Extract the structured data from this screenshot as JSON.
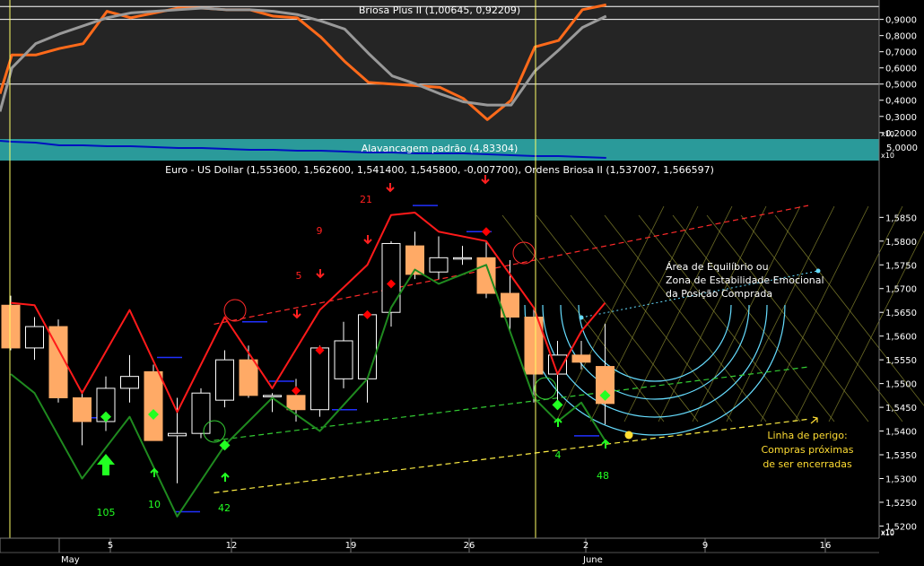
{
  "oscillator_panel": {
    "title": "Briosa Plus II (1,00645, 0,92209)",
    "y_ticks": [
      0.2,
      0.3,
      0.4,
      0.5,
      0.6,
      0.7,
      0.8,
      0.9
    ],
    "y_tick_labels": [
      "0,2000",
      "0,3000",
      "0,4000",
      "0,5000",
      "0,6000",
      "0,7000",
      "0,8000",
      "0,9000"
    ],
    "ylim": [
      0.16,
      1.02
    ],
    "reference_lines": [
      0.98,
      0.9,
      0.5
    ],
    "scale_tag": "x10",
    "colors": {
      "fast": "#ff6a1a",
      "slow": "#999999"
    }
  },
  "leverage_panel": {
    "title": "Alavancagem padrão (4,83304)",
    "y_tick_label": "5,0000",
    "scale_tag": "x10",
    "colors": {
      "background": "#2a9a9a",
      "line": "#0010c0"
    }
  },
  "price_panel": {
    "title": "Euro - US Dollar (1,553600, 1,562600, 1,541400, 1,545800, -0,007700), Ordens Briosa II (1,537007, 1,566597)",
    "y_ticks": [
      1.52,
      1.525,
      1.53,
      1.535,
      1.54,
      1.545,
      1.55,
      1.555,
      1.56,
      1.565,
      1.57,
      1.575,
      1.58,
      1.585
    ],
    "y_tick_labels": [
      "1,5200",
      "1,5250",
      "1,5300",
      "1,5350",
      "1,5400",
      "1,5450",
      "1,5500",
      "1,5550",
      "1,5600",
      "1,5650",
      "1,5700",
      "1,5750",
      "1,5800",
      "1,5850"
    ],
    "ylim": [
      1.518,
      1.593
    ],
    "scale_tag": "x10",
    "annotations": {
      "zone_text": [
        "Área de Equilíbrio ou",
        "Zona de Estabilidade Emocional",
        "da Posição Comprada"
      ],
      "danger_text": [
        "Linha de perigo:",
        "Compras próximas",
        "de ser encerradas"
      ],
      "counts_red": [
        "21",
        "9",
        "5"
      ],
      "counts_green": [
        "105",
        "10",
        "42",
        "4",
        "48"
      ]
    },
    "colors": {
      "bull_candle": "#ffaa66",
      "bear_candle": "#ffaa66",
      "upper_line": "#ff1a1a",
      "lower_line": "#1f8a1f",
      "signal": "#ff0000",
      "buy": "#22ff22",
      "danger": "#ffdd33",
      "zone": "#66ddff"
    }
  },
  "x_axis": {
    "day_labels": [
      "5",
      "12",
      "19",
      "26",
      "2",
      "9",
      "16"
    ],
    "month_labels": [
      "May",
      "June"
    ],
    "scale_tag": "x10"
  },
  "chart_data": [
    {
      "type": "line",
      "title": "Briosa Plus II (1,00645, 0,92209)",
      "x": [
        0,
        1,
        2,
        3,
        4,
        5,
        6,
        7,
        8,
        9,
        10,
        11,
        12,
        13,
        14,
        15,
        16,
        17,
        18,
        19,
        20,
        21,
        22,
        23,
        24,
        25,
        26,
        27,
        28,
        29,
        30,
        31,
        32,
        33,
        34,
        35,
        36,
        37,
        38,
        39,
        40,
        41,
        42,
        43,
        44,
        45,
        46,
        47,
        48,
        49,
        50,
        51
      ],
      "series": [
        {
          "name": "fast",
          "x": [
            0,
            1,
            3,
            5,
            7,
            9,
            11,
            13,
            15,
            17,
            19,
            21,
            23,
            25,
            27,
            29,
            31,
            33,
            35,
            37,
            39,
            41,
            43,
            45,
            47,
            49,
            51
          ],
          "values": [
            0.44,
            0.68,
            0.68,
            0.72,
            0.75,
            0.95,
            0.91,
            0.94,
            0.97,
            0.97,
            0.96,
            0.96,
            0.92,
            0.91,
            0.79,
            0.64,
            0.51,
            0.5,
            0.49,
            0.48,
            0.41,
            0.28,
            0.4,
            0.73,
            0.77,
            0.96,
            0.99
          ]
        },
        {
          "name": "slow",
          "x": [
            0,
            1,
            3,
            5,
            7,
            9,
            11,
            13,
            15,
            17,
            19,
            21,
            23,
            25,
            27,
            29,
            31,
            33,
            35,
            37,
            39,
            41,
            43,
            45,
            47,
            49,
            51
          ],
          "values": [
            0.33,
            0.6,
            0.75,
            0.81,
            0.86,
            0.91,
            0.94,
            0.95,
            0.96,
            0.97,
            0.96,
            0.96,
            0.95,
            0.93,
            0.89,
            0.84,
            0.69,
            0.55,
            0.5,
            0.44,
            0.39,
            0.37,
            0.37,
            0.58,
            0.71,
            0.85,
            0.92
          ]
        }
      ]
    },
    {
      "type": "line",
      "title": "Alavancagem padrão (4,83304)",
      "series": [
        {
          "name": "leverage",
          "x": [
            0,
            1,
            3,
            5,
            7,
            9,
            11,
            13,
            15,
            17,
            19,
            21,
            23,
            25,
            27,
            29,
            31,
            33,
            35,
            37,
            39,
            41,
            43,
            45,
            47,
            49,
            51
          ],
          "values": [
            5.02,
            5.01,
            5.0,
            4.97,
            4.97,
            4.96,
            4.96,
            4.95,
            4.94,
            4.94,
            4.93,
            4.92,
            4.92,
            4.91,
            4.91,
            4.9,
            4.89,
            4.89,
            4.88,
            4.88,
            4.88,
            4.87,
            4.86,
            4.85,
            4.85,
            4.84,
            4.83
          ]
        }
      ]
    },
    {
      "type": "candlestick",
      "title": "Euro - US Dollar (1,553600, 1,562600, 1,541400, 1,545800, -0,007700), Ordens Briosa II (1,537007, 1,566597)",
      "candles": [
        {
          "x": 0,
          "open": 1.5665,
          "high": 1.5685,
          "low": 1.557,
          "close": 1.5575
        },
        {
          "x": 2,
          "open": 1.5575,
          "high": 1.564,
          "low": 1.555,
          "close": 1.562
        },
        {
          "x": 4,
          "open": 1.562,
          "high": 1.5635,
          "low": 1.546,
          "close": 1.547
        },
        {
          "x": 6,
          "open": 1.547,
          "high": 1.5485,
          "low": 1.537,
          "close": 1.542
        },
        {
          "x": 8,
          "open": 1.542,
          "high": 1.5515,
          "low": 1.54,
          "close": 1.549
        },
        {
          "x": 10,
          "open": 1.549,
          "high": 1.556,
          "low": 1.546,
          "close": 1.5515
        },
        {
          "x": 12,
          "open": 1.5525,
          "high": 1.554,
          "low": 1.539,
          "close": 1.538
        },
        {
          "x": 14,
          "open": 1.539,
          "high": 1.547,
          "low": 1.529,
          "close": 1.5395
        },
        {
          "x": 16,
          "open": 1.5395,
          "high": 1.549,
          "low": 1.5385,
          "close": 1.548
        },
        {
          "x": 18,
          "open": 1.5465,
          "high": 1.557,
          "low": 1.545,
          "close": 1.555
        },
        {
          "x": 20,
          "open": 1.555,
          "high": 1.558,
          "low": 1.547,
          "close": 1.5475
        },
        {
          "x": 22,
          "open": 1.5475,
          "high": 1.548,
          "low": 1.544,
          "close": 1.5475
        },
        {
          "x": 24,
          "open": 1.5475,
          "high": 1.551,
          "low": 1.542,
          "close": 1.5445
        },
        {
          "x": 26,
          "open": 1.5445,
          "high": 1.558,
          "low": 1.543,
          "close": 1.5575
        },
        {
          "x": 28,
          "open": 1.551,
          "high": 1.563,
          "low": 1.549,
          "close": 1.559
        },
        {
          "x": 30,
          "open": 1.551,
          "high": 1.565,
          "low": 1.546,
          "close": 1.5645
        },
        {
          "x": 32,
          "open": 1.565,
          "high": 1.58,
          "low": 1.562,
          "close": 1.5795
        },
        {
          "x": 34,
          "open": 1.579,
          "high": 1.582,
          "low": 1.572,
          "close": 1.573
        },
        {
          "x": 36,
          "open": 1.5735,
          "high": 1.581,
          "low": 1.572,
          "close": 1.5765
        },
        {
          "x": 38,
          "open": 1.5765,
          "high": 1.579,
          "low": 1.575,
          "close": 1.5765
        },
        {
          "x": 40,
          "open": 1.5765,
          "high": 1.58,
          "low": 1.568,
          "close": 1.569
        },
        {
          "x": 42,
          "open": 1.569,
          "high": 1.576,
          "low": 1.561,
          "close": 1.564
        },
        {
          "x": 44,
          "open": 1.564,
          "high": 1.566,
          "low": 1.546,
          "close": 1.552
        },
        {
          "x": 46,
          "open": 1.552,
          "high": 1.559,
          "low": 1.546,
          "close": 1.556
        },
        {
          "x": 48,
          "open": 1.556,
          "high": 1.559,
          "low": 1.553,
          "close": 1.5545
        },
        {
          "x": 50,
          "open": 1.5536,
          "high": 1.5626,
          "low": 1.5414,
          "close": 1.5458
        }
      ],
      "series": [
        {
          "name": "upper",
          "x": [
            0,
            2,
            6,
            10,
            14,
            18,
            22,
            26,
            30,
            32,
            34,
            36,
            40,
            42,
            44,
            46,
            48,
            50
          ],
          "values": [
            1.567,
            1.5665,
            1.548,
            1.5655,
            1.544,
            1.564,
            1.549,
            1.5655,
            1.575,
            1.5855,
            1.586,
            1.582,
            1.58,
            1.573,
            1.566,
            1.552,
            1.561,
            1.567
          ]
        },
        {
          "name": "lower",
          "x": [
            0,
            2,
            6,
            10,
            14,
            18,
            22,
            26,
            30,
            32,
            34,
            36,
            40,
            42,
            44,
            46,
            48,
            50
          ],
          "values": [
            1.552,
            1.548,
            1.53,
            1.543,
            1.522,
            1.537,
            1.547,
            1.54,
            1.551,
            1.566,
            1.574,
            1.571,
            1.575,
            1.561,
            1.547,
            1.542,
            1.546,
            1.538
          ]
        }
      ],
      "sell_markers": [
        {
          "x": 24,
          "y": 1.5485
        },
        {
          "x": 26,
          "y": 1.557
        },
        {
          "x": 30,
          "y": 1.5645
        },
        {
          "x": 32,
          "y": 1.571
        },
        {
          "x": 40,
          "y": 1.582
        }
      ],
      "buy_markers": [
        {
          "x": 8,
          "y": 1.543
        },
        {
          "x": 12,
          "y": 1.5435
        },
        {
          "x": 18,
          "y": 1.537
        },
        {
          "x": 46,
          "y": 1.5455
        },
        {
          "x": 50,
          "y": 1.5475
        }
      ],
      "trend_lines": [
        {
          "name": "red",
          "from": [
            18,
            1.5625
          ],
          "to": [
            68,
            1.5875
          ]
        },
        {
          "name": "green",
          "from": [
            18,
            1.538
          ],
          "to": [
            68,
            1.5535
          ]
        },
        {
          "name": "yellow",
          "from": [
            18,
            1.527
          ],
          "to": [
            68,
            1.5425
          ]
        }
      ]
    }
  ]
}
